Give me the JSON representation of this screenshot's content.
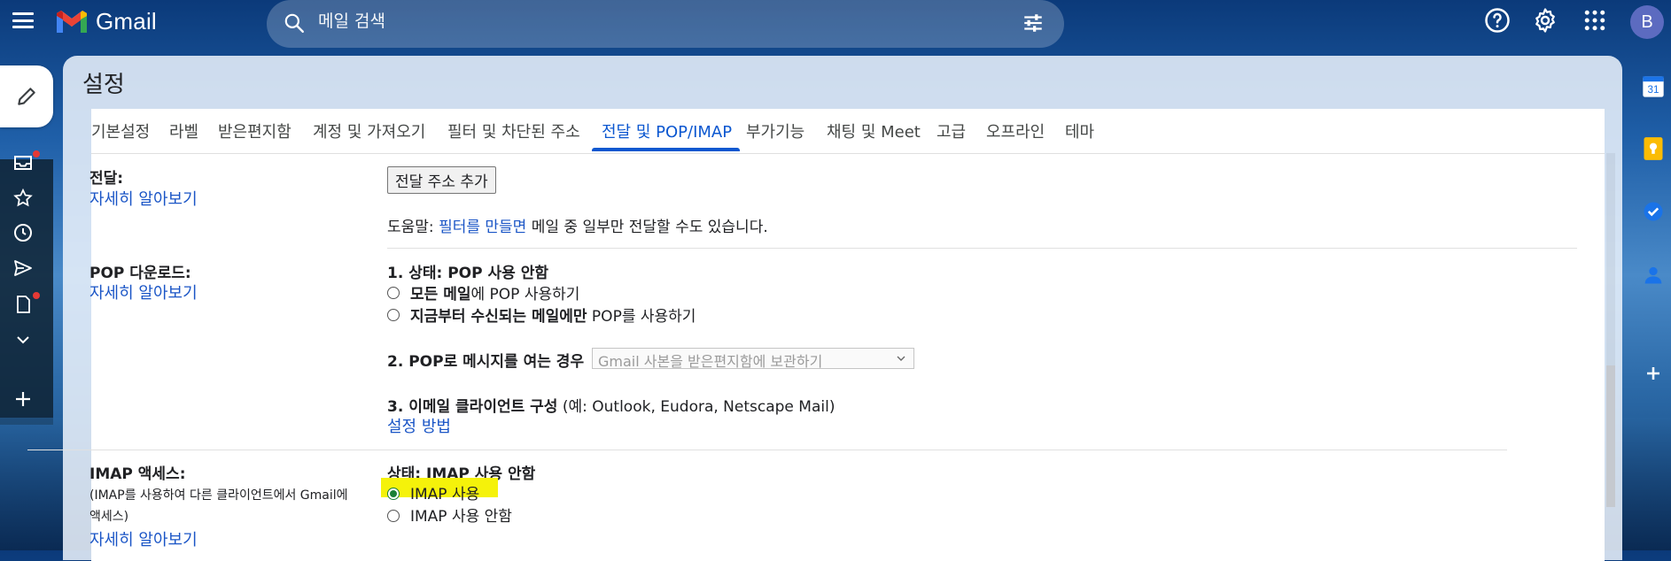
{
  "app": {
    "name": "Gmail",
    "avatar_letter": "B"
  },
  "search": {
    "placeholder": "메일 검색"
  },
  "page": {
    "title": "설정"
  },
  "tabs": [
    {
      "label": "기본설정"
    },
    {
      "label": "라벨"
    },
    {
      "label": "받은편지함"
    },
    {
      "label": "계정 및 가져오기"
    },
    {
      "label": "필터 및 차단된 주소"
    },
    {
      "label": "전달 및 POP/IMAP",
      "active": true
    },
    {
      "label": "부가기능"
    },
    {
      "label": "채팅 및 Meet"
    },
    {
      "label": "고급"
    },
    {
      "label": "오프라인"
    },
    {
      "label": "테마"
    }
  ],
  "forwarding": {
    "label": "전달:",
    "learn_more": "자세히 알아보기",
    "add_button": "전달 주소 추가",
    "tip_prefix": "도움말: ",
    "tip_link": "필터를 만들면",
    "tip_suffix": " 메일 중 일부만 전달할 수도 있습니다."
  },
  "pop": {
    "label": "POP 다운로드:",
    "learn_more": "자세히 알아보기",
    "status": "1. 상태: POP 사용 안함",
    "option_all_bold": "모든 메일",
    "option_all_rest": "에 POP 사용하기",
    "option_new_bold": "지금부터 수신되는 메일에만",
    "option_new_rest": " POP를 사용하기",
    "when_label": "2. POP로 메시지를 여는 경우",
    "when_select": "Gmail 사본을 받은편지함에 보관하기",
    "client_bold": "3. 이메일 클라이언트 구성",
    "client_rest": " (예: Outlook, Eudora, Netscape Mail)",
    "setup_link": "설정 방법"
  },
  "imap": {
    "label": "IMAP 액세스:",
    "desc_line1": "(IMAP를 사용하여 다른 클라이언트에서 Gmail에",
    "desc_line2": "액세스)",
    "learn_more": "자세히 알아보기",
    "status": "상태: IMAP 사용 안함",
    "option_enable": "IMAP 사용",
    "option_disable": "IMAP 사용 안함",
    "selected": "enable"
  },
  "colors": {
    "accent": "#0b57d0",
    "link": "#1a55c6",
    "highlight": "#f5f20a"
  }
}
